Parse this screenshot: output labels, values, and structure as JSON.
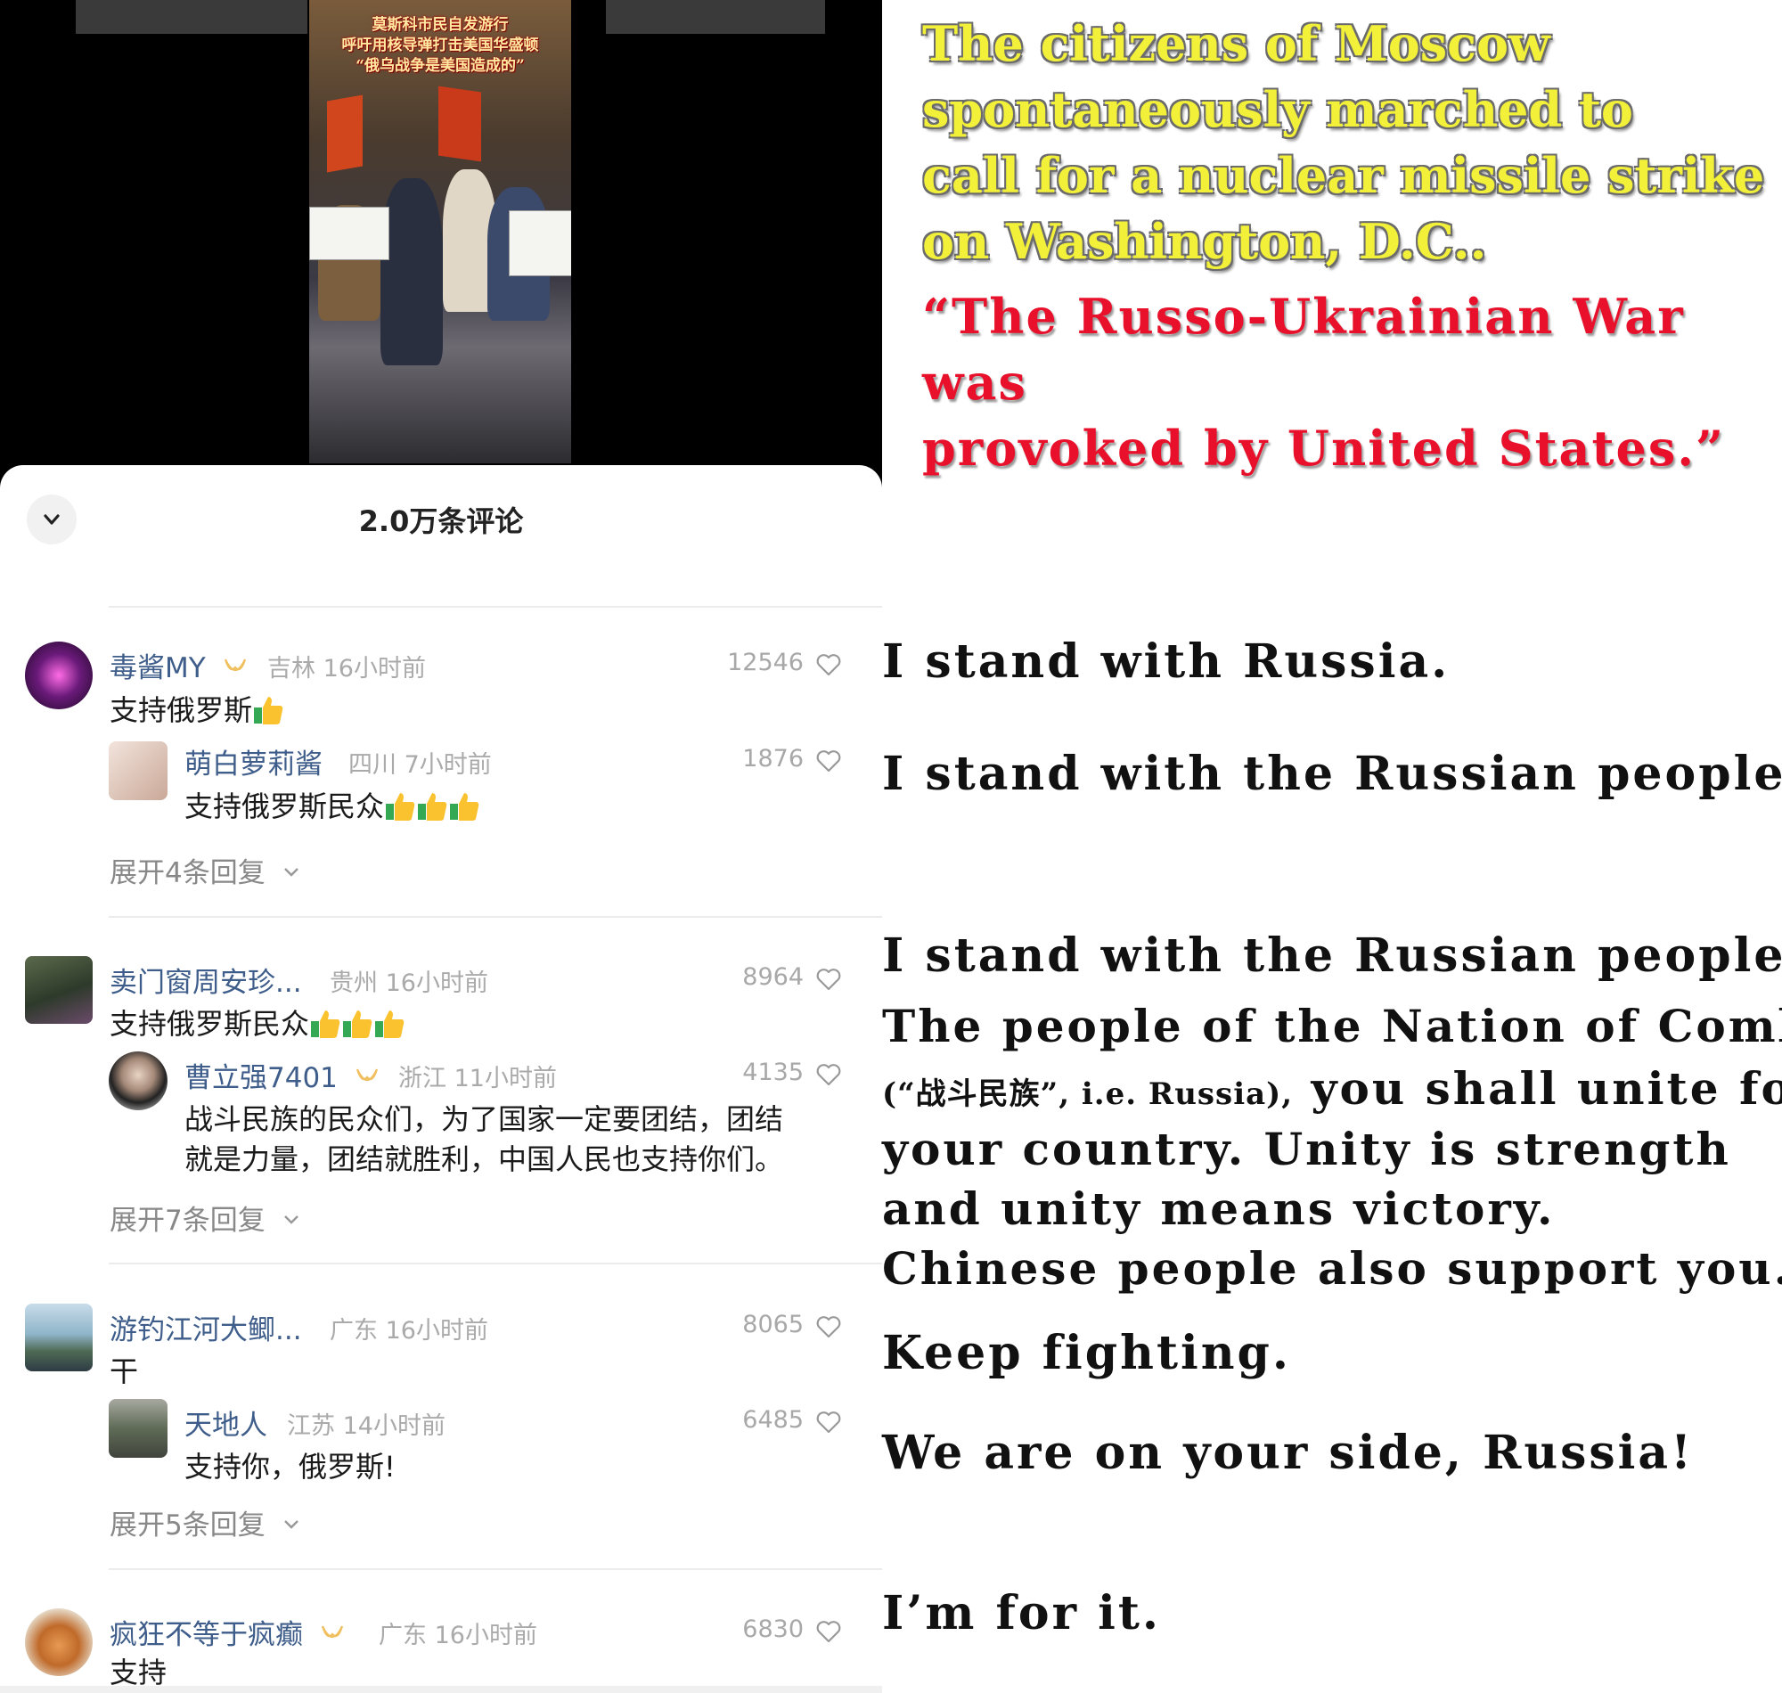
{
  "video": {
    "caption_lines": [
      "莫斯科市民自发游行",
      "呼吁用核导弹打击美国华盛顿",
      "“俄乌战争是美国造成的”"
    ]
  },
  "sheet": {
    "title": "2.0万条评论"
  },
  "comments": [
    {
      "user": "毒酱MY",
      "region": "吉林",
      "time": "16小时前",
      "likes": "12546",
      "text": "支持俄罗斯",
      "reply": {
        "user": "萌白萝莉酱",
        "region": "四川",
        "time": "7小时前",
        "likes": "1876",
        "text": "支持俄罗斯民众"
      },
      "expand": "展开4条回复"
    },
    {
      "user": "卖门窗周安珍...",
      "region": "贵州",
      "time": "16小时前",
      "likes": "8964",
      "text": "支持俄罗斯民众",
      "reply": {
        "user": "曹立强7401",
        "region": "浙江",
        "time": "11小时前",
        "likes": "4135",
        "text_line1": "战斗民族的民众们，为了国家一定要团结，团结",
        "text_line2": "就是力量，团结就胜利，中国人民也支持你们。"
      },
      "expand": "展开7条回复"
    },
    {
      "user": "游钓江河大鲫...",
      "region": "广东",
      "time": "16小时前",
      "likes": "8065",
      "text": "干",
      "reply": {
        "user": "天地人",
        "region": "江苏",
        "time": "14小时前",
        "likes": "6485",
        "text": "支持你，俄罗斯!"
      },
      "expand": "展开5条回复"
    },
    {
      "user": "疯狂不等于疯癫",
      "region": "广东",
      "time": "16小时前",
      "likes": "6830",
      "text": "支持"
    }
  ],
  "translation": {
    "headline_lines": [
      "The citizens of Moscow",
      "spontaneously marched to",
      "call for a nuclear missile strike",
      "on Washington, D.C.."
    ],
    "quote_lines": [
      "“The Russo-Ukrainian War was",
      "provoked by United States.”"
    ],
    "t1": "I stand with Russia.",
    "t2": "I stand with the Russian people.",
    "t3_lines": [
      "I stand with the Russian people.",
      "The people of the Nation of Combat"
    ],
    "t3_small": "(“战斗民族”, i.e. Russia),",
    "t3_rest": " you shall unite for",
    "t3_more": [
      "your country. Unity is strength",
      "and unity means victory.",
      "Chinese people also support you."
    ],
    "t4": "Keep fighting.",
    "t5": "We are on your side, Russia!",
    "t6": "I’m for it."
  },
  "colors": {
    "username": "#3e5d8a",
    "meta_gray": "#aaaaaa",
    "headline_yellow": "#f3f03a",
    "quote_red": "#e8102a"
  }
}
